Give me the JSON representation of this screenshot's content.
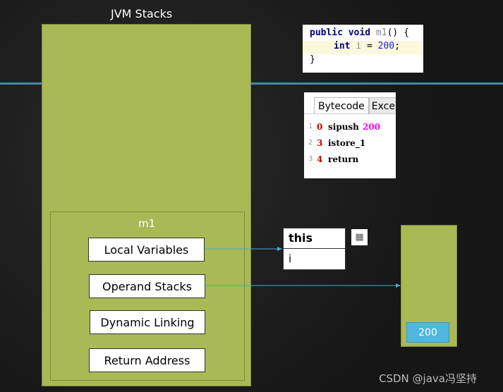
{
  "title": "JVM Stacks",
  "frame": {
    "name": "m1",
    "items": [
      "Local Variables",
      "Operand Stacks",
      "Dynamic Linking",
      "Return Address"
    ]
  },
  "source": {
    "line1": {
      "kw1": "public",
      "kw2": "void",
      "name": "m1",
      "rest": "() {"
    },
    "line2": {
      "kw": "int",
      "var": "i",
      "eq": "=",
      "num": "200",
      "end": ";"
    },
    "line3": "}"
  },
  "bytecode": {
    "tabs": [
      "Bytecode",
      "Exce"
    ],
    "rows": [
      {
        "line": "1",
        "offset": "0",
        "op": "sipush",
        "arg": "200"
      },
      {
        "line": "2",
        "offset": "3",
        "op": "istore_1",
        "arg": ""
      },
      {
        "line": "3",
        "offset": "4",
        "op": "return",
        "arg": ""
      }
    ]
  },
  "locals": [
    "this",
    "i"
  ],
  "operand_stack": [
    "200"
  ],
  "watermark": "CSDN @java冯坚持",
  "colors": {
    "green": "#a9b956",
    "blue": "#4fb7e0",
    "arrow": "#4aa8d0"
  }
}
